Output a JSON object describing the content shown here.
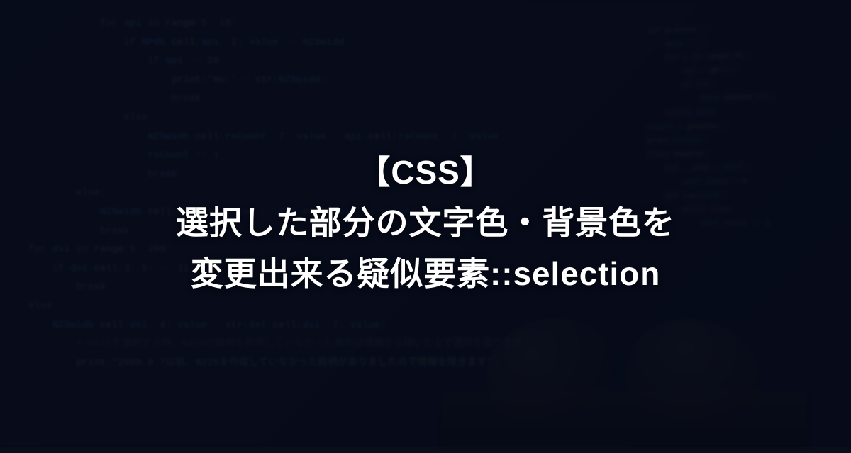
{
  "title": {
    "line1": "【CSS】",
    "line2": "選択した部分の文字色・背景色を",
    "line3": "変更出来る疑似要素::selection"
  },
  "bg_code_left": [
    {
      "indent": 3,
      "tokens": [
        {
          "t": "kw",
          "v": "for"
        },
        {
          "t": "",
          "v": " "
        },
        {
          "t": "var",
          "v": "api"
        },
        {
          "t": "",
          "v": " "
        },
        {
          "t": "kw",
          "v": "in"
        },
        {
          "t": "",
          "v": " "
        },
        {
          "t": "fn",
          "v": "range"
        },
        {
          "t": "",
          "v": "("
        },
        {
          "t": "num",
          "v": "5"
        },
        {
          "t": "",
          "v": ", "
        },
        {
          "t": "num",
          "v": "10"
        },
        {
          "t": "",
          "v": "):"
        }
      ]
    },
    {
      "indent": 4,
      "tokens": [
        {
          "t": "kw",
          "v": "if"
        },
        {
          "t": "",
          "v": " "
        },
        {
          "t": "var",
          "v": "NPdb"
        },
        {
          "t": "",
          "v": "."
        },
        {
          "t": "fn",
          "v": "cell"
        },
        {
          "t": "",
          "v": "("
        },
        {
          "t": "var",
          "v": "api"
        },
        {
          "t": "",
          "v": ", "
        },
        {
          "t": "num",
          "v": "2"
        },
        {
          "t": "",
          "v": ")."
        },
        {
          "t": "var",
          "v": "value"
        },
        {
          "t": "",
          "v": " != "
        },
        {
          "t": "var",
          "v": "NZSwidd"
        },
        {
          "t": "",
          "v": ":"
        }
      ]
    },
    {
      "indent": 5,
      "tokens": [
        {
          "t": "kw",
          "v": "if"
        },
        {
          "t": "",
          "v": " "
        },
        {
          "t": "var",
          "v": "api"
        },
        {
          "t": "",
          "v": " == "
        },
        {
          "t": "num",
          "v": "10"
        },
        {
          "t": "",
          "v": ":"
        }
      ]
    },
    {
      "indent": 6,
      "tokens": [
        {
          "t": "fn",
          "v": "print"
        },
        {
          "t": "",
          "v": "("
        },
        {
          "t": "str",
          "v": "'No:'"
        },
        {
          "t": "",
          "v": " + "
        },
        {
          "t": "fn",
          "v": "str"
        },
        {
          "t": "",
          "v": "("
        },
        {
          "t": "var",
          "v": "NZSwidd"
        },
        {
          "t": "",
          "v": "))"
        }
      ]
    },
    {
      "indent": 6,
      "tokens": [
        {
          "t": "kw",
          "v": "break"
        }
      ]
    },
    {
      "indent": 4,
      "tokens": [
        {
          "t": "kw",
          "v": "else"
        },
        {
          "t": "",
          "v": ":"
        }
      ]
    },
    {
      "indent": 5,
      "tokens": [
        {
          "t": "var",
          "v": "NZSwidb"
        },
        {
          "t": "",
          "v": "."
        },
        {
          "t": "fn",
          "v": "cell"
        },
        {
          "t": "",
          "v": "("
        },
        {
          "t": "var",
          "v": "rsCount"
        },
        {
          "t": "",
          "v": ", "
        },
        {
          "t": "num",
          "v": "7"
        },
        {
          "t": "",
          "v": ")."
        },
        {
          "t": "var",
          "v": "value"
        },
        {
          "t": "",
          "v": " = "
        },
        {
          "t": "var",
          "v": "api"
        },
        {
          "t": "",
          "v": "."
        },
        {
          "t": "fn",
          "v": "cell"
        },
        {
          "t": "",
          "v": "("
        },
        {
          "t": "var",
          "v": "rsCount"
        },
        {
          "t": "",
          "v": ", "
        },
        {
          "t": "num",
          "v": "7"
        },
        {
          "t": "",
          "v": ")."
        },
        {
          "t": "var",
          "v": "value"
        }
      ]
    },
    {
      "indent": 5,
      "tokens": [
        {
          "t": "var",
          "v": "rsCount"
        },
        {
          "t": "",
          "v": " += "
        },
        {
          "t": "num",
          "v": "1"
        }
      ]
    },
    {
      "indent": 5,
      "tokens": [
        {
          "t": "kw",
          "v": "break"
        }
      ]
    },
    {
      "indent": 0,
      "tokens": [
        {
          "t": "",
          "v": ""
        }
      ]
    },
    {
      "indent": 2,
      "tokens": [
        {
          "t": "kw",
          "v": "else"
        },
        {
          "t": "",
          "v": ":"
        }
      ]
    },
    {
      "indent": 3,
      "tokens": [
        {
          "t": "var",
          "v": "NZSwidb"
        },
        {
          "t": "",
          "v": "."
        },
        {
          "t": "fn",
          "v": "cell"
        },
        {
          "t": "",
          "v": "("
        },
        {
          "t": "var",
          "v": "dxi"
        },
        {
          "t": "",
          "v": ", "
        },
        {
          "t": "num",
          "v": "4"
        },
        {
          "t": "",
          "v": ")."
        },
        {
          "t": "var",
          "v": "value"
        },
        {
          "t": "",
          "v": " = ("
        },
        {
          "t": "var",
          "v": "dxt"
        },
        {
          "t": "",
          "v": "."
        },
        {
          "t": "fn",
          "v": "cell"
        },
        {
          "t": "",
          "v": "("
        },
        {
          "t": "var",
          "v": "dxi"
        },
        {
          "t": "",
          "v": ", "
        },
        {
          "t": "num",
          "v": "4"
        },
        {
          "t": "",
          "v": ")."
        },
        {
          "t": "var",
          "v": "value"
        },
        {
          "t": "",
          "v": ")"
        }
      ]
    },
    {
      "indent": 3,
      "tokens": [
        {
          "t": "kw",
          "v": "break"
        }
      ]
    },
    {
      "indent": 0,
      "tokens": [
        {
          "t": "",
          "v": ""
        }
      ]
    },
    {
      "indent": 0,
      "tokens": [
        {
          "t": "kw",
          "v": "for"
        },
        {
          "t": "",
          "v": " "
        },
        {
          "t": "var",
          "v": "dxi"
        },
        {
          "t": "",
          "v": " "
        },
        {
          "t": "kw",
          "v": "in"
        },
        {
          "t": "",
          "v": " "
        },
        {
          "t": "fn",
          "v": "range"
        },
        {
          "t": "",
          "v": "("
        },
        {
          "t": "num",
          "v": "5"
        },
        {
          "t": "",
          "v": ", "
        },
        {
          "t": "num",
          "v": "200"
        },
        {
          "t": "",
          "v": "):"
        }
      ]
    },
    {
      "indent": 1,
      "tokens": [
        {
          "t": "kw",
          "v": "if"
        },
        {
          "t": "",
          "v": " "
        },
        {
          "t": "var",
          "v": "dxt"
        },
        {
          "t": "",
          "v": "."
        },
        {
          "t": "fn",
          "v": "cell"
        },
        {
          "t": "",
          "v": "("
        },
        {
          "t": "num",
          "v": "3"
        },
        {
          "t": "",
          "v": ", "
        },
        {
          "t": "num",
          "v": "5"
        },
        {
          "t": "",
          "v": ") == "
        },
        {
          "t": "num",
          "v": "11"
        },
        {
          "t": "",
          "v": ":"
        }
      ]
    },
    {
      "indent": 2,
      "tokens": [
        {
          "t": "kw",
          "v": "break"
        }
      ]
    },
    {
      "indent": 0,
      "tokens": [
        {
          "t": "",
          "v": ""
        }
      ]
    },
    {
      "indent": 0,
      "tokens": [
        {
          "t": "kw",
          "v": "else"
        },
        {
          "t": "",
          "v": ":"
        }
      ]
    },
    {
      "indent": 1,
      "tokens": [
        {
          "t": "var",
          "v": "NZSwidb"
        },
        {
          "t": "",
          "v": "."
        },
        {
          "t": "fn",
          "v": "cell"
        },
        {
          "t": "",
          "v": "("
        },
        {
          "t": "var",
          "v": "dxi"
        },
        {
          "t": "",
          "v": ", "
        },
        {
          "t": "num",
          "v": "4"
        },
        {
          "t": "",
          "v": ")."
        },
        {
          "t": "var",
          "v": "value"
        },
        {
          "t": "",
          "v": " = "
        },
        {
          "t": "fn",
          "v": "str"
        },
        {
          "t": "",
          "v": "("
        },
        {
          "t": "var",
          "v": "dxt"
        },
        {
          "t": "",
          "v": "."
        },
        {
          "t": "fn",
          "v": "cell"
        },
        {
          "t": "",
          "v": "("
        },
        {
          "t": "var",
          "v": "dxi"
        },
        {
          "t": "",
          "v": ", "
        },
        {
          "t": "num",
          "v": "7"
        },
        {
          "t": "",
          "v": ")."
        },
        {
          "t": "var",
          "v": "value"
        },
        {
          "t": "",
          "v": ")"
        }
      ]
    },
    {
      "indent": 0,
      "tokens": [
        {
          "t": "",
          "v": ""
        }
      ]
    },
    {
      "indent": 2,
      "tokens": [
        {
          "t": "cmt",
          "v": "# N225を選択する際、N225の銘柄を取得していなかった場合は情報から除いた上で選択を図ります"
        }
      ]
    },
    {
      "indent": 2,
      "tokens": [
        {
          "t": "fn",
          "v": "print"
        },
        {
          "t": "",
          "v": "("
        },
        {
          "t": "str",
          "v": "\"2008-8.7以前、N225を作成していなかった銘柄がありましたので情報を除きます\""
        },
        {
          "t": "",
          "v": ")"
        }
      ]
    }
  ],
  "bg_code_right": [
    {
      "indent": 0,
      "tokens": [
        {
          "t": "kw",
          "v": "def"
        },
        {
          "t": "",
          "v": " "
        },
        {
          "t": "fn",
          "v": "process"
        },
        {
          "t": "",
          "v": "():"
        }
      ]
    },
    {
      "indent": 1,
      "tokens": [
        {
          "t": "var",
          "v": "data"
        },
        {
          "t": "",
          "v": " = []"
        }
      ]
    },
    {
      "indent": 1,
      "tokens": [
        {
          "t": "kw",
          "v": "for"
        },
        {
          "t": "",
          "v": " "
        },
        {
          "t": "var",
          "v": "i"
        },
        {
          "t": "",
          "v": " "
        },
        {
          "t": "kw",
          "v": "in"
        },
        {
          "t": "",
          "v": " "
        },
        {
          "t": "fn",
          "v": "range"
        },
        {
          "t": "",
          "v": "("
        },
        {
          "t": "num",
          "v": "10"
        },
        {
          "t": "",
          "v": "):"
        }
      ]
    },
    {
      "indent": 2,
      "tokens": [
        {
          "t": "var",
          "v": "val"
        },
        {
          "t": "",
          "v": " = "
        },
        {
          "t": "fn",
          "v": "get"
        },
        {
          "t": "",
          "v": "("
        },
        {
          "t": "var",
          "v": "i"
        },
        {
          "t": "",
          "v": ")"
        }
      ]
    },
    {
      "indent": 2,
      "tokens": [
        {
          "t": "kw",
          "v": "if"
        },
        {
          "t": "",
          "v": " "
        },
        {
          "t": "var",
          "v": "val"
        },
        {
          "t": "",
          "v": ":"
        }
      ]
    },
    {
      "indent": 3,
      "tokens": [
        {
          "t": "var",
          "v": "data"
        },
        {
          "t": "",
          "v": "."
        },
        {
          "t": "fn",
          "v": "append"
        },
        {
          "t": "",
          "v": "("
        },
        {
          "t": "var",
          "v": "val"
        },
        {
          "t": "",
          "v": ")"
        }
      ]
    },
    {
      "indent": 1,
      "tokens": [
        {
          "t": "kw",
          "v": "return"
        },
        {
          "t": "",
          "v": " "
        },
        {
          "t": "var",
          "v": "data"
        }
      ]
    },
    {
      "indent": 0,
      "tokens": [
        {
          "t": "",
          "v": ""
        }
      ]
    },
    {
      "indent": 0,
      "tokens": [
        {
          "t": "var",
          "v": "result"
        },
        {
          "t": "",
          "v": " = "
        },
        {
          "t": "fn",
          "v": "process"
        },
        {
          "t": "",
          "v": "()"
        }
      ]
    },
    {
      "indent": 0,
      "tokens": [
        {
          "t": "fn",
          "v": "print"
        },
        {
          "t": "",
          "v": "("
        },
        {
          "t": "var",
          "v": "result"
        },
        {
          "t": "",
          "v": ")"
        }
      ]
    },
    {
      "indent": 0,
      "tokens": [
        {
          "t": "",
          "v": ""
        }
      ]
    },
    {
      "indent": 0,
      "tokens": [
        {
          "t": "kw",
          "v": "class"
        },
        {
          "t": "",
          "v": " "
        },
        {
          "t": "fn",
          "v": "Handler"
        },
        {
          "t": "",
          "v": ":"
        }
      ]
    },
    {
      "indent": 1,
      "tokens": [
        {
          "t": "kw",
          "v": "def"
        },
        {
          "t": "",
          "v": " "
        },
        {
          "t": "fn",
          "v": "__init__"
        },
        {
          "t": "",
          "v": "("
        },
        {
          "t": "var",
          "v": "self"
        },
        {
          "t": "",
          "v": "):"
        }
      ]
    },
    {
      "indent": 2,
      "tokens": [
        {
          "t": "var",
          "v": "self"
        },
        {
          "t": "",
          "v": "."
        },
        {
          "t": "var",
          "v": "count"
        },
        {
          "t": "",
          "v": " = "
        },
        {
          "t": "num",
          "v": "0"
        }
      ]
    },
    {
      "indent": 0,
      "tokens": [
        {
          "t": "",
          "v": ""
        }
      ]
    },
    {
      "indent": 1,
      "tokens": [
        {
          "t": "kw",
          "v": "def"
        },
        {
          "t": "",
          "v": " "
        },
        {
          "t": "fn",
          "v": "run"
        },
        {
          "t": "",
          "v": "("
        },
        {
          "t": "var",
          "v": "self"
        },
        {
          "t": "",
          "v": "):"
        }
      ]
    },
    {
      "indent": 2,
      "tokens": [
        {
          "t": "kw",
          "v": "while"
        },
        {
          "t": "",
          "v": " "
        },
        {
          "t": "kw",
          "v": "True"
        },
        {
          "t": "",
          "v": ":"
        }
      ]
    },
    {
      "indent": 3,
      "tokens": [
        {
          "t": "var",
          "v": "self"
        },
        {
          "t": "",
          "v": "."
        },
        {
          "t": "var",
          "v": "count"
        },
        {
          "t": "",
          "v": " += "
        },
        {
          "t": "num",
          "v": "1"
        }
      ]
    }
  ]
}
